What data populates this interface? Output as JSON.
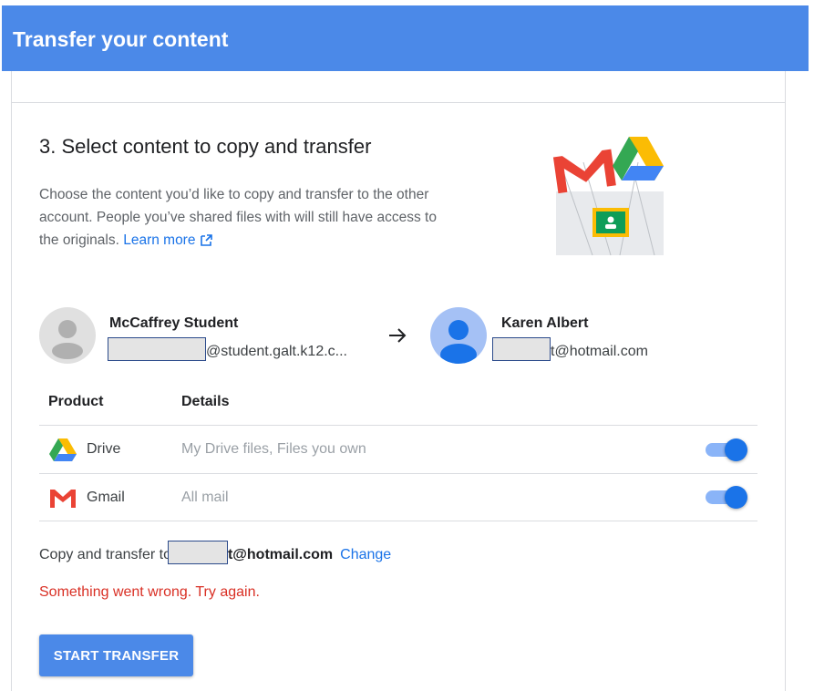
{
  "header": {
    "title": "Transfer your content"
  },
  "step": {
    "title": "3. Select content to copy and transfer",
    "description": "Choose the content you’d like to copy and transfer to the other account. People you’ve shared files with will still have access to the originals.",
    "learn_more": "Learn more"
  },
  "accounts": {
    "source": {
      "name": "McCaffrey Student",
      "email_suffix": "@student.galt.k12.c..."
    },
    "destination": {
      "name": "Karen Albert",
      "email_suffix": "t@hotmail.com"
    }
  },
  "table": {
    "headers": {
      "product": "Product",
      "details": "Details"
    },
    "rows": [
      {
        "icon": "drive-icon",
        "product": "Drive",
        "details": "My Drive files, Files you own",
        "enabled": true
      },
      {
        "icon": "gmail-icon",
        "product": "Gmail",
        "details": "All mail",
        "enabled": true
      }
    ]
  },
  "summary": {
    "prefix": "Copy and transfer to",
    "email_suffix": "t@hotmail.com",
    "change_label": "Change"
  },
  "error_message": "Something went wrong. Try again.",
  "start_button": "START TRANSFER",
  "colors": {
    "header": "#4b89e8",
    "link": "#1a73e8",
    "error": "#d93025",
    "toggle_on": "#1a73e8"
  }
}
